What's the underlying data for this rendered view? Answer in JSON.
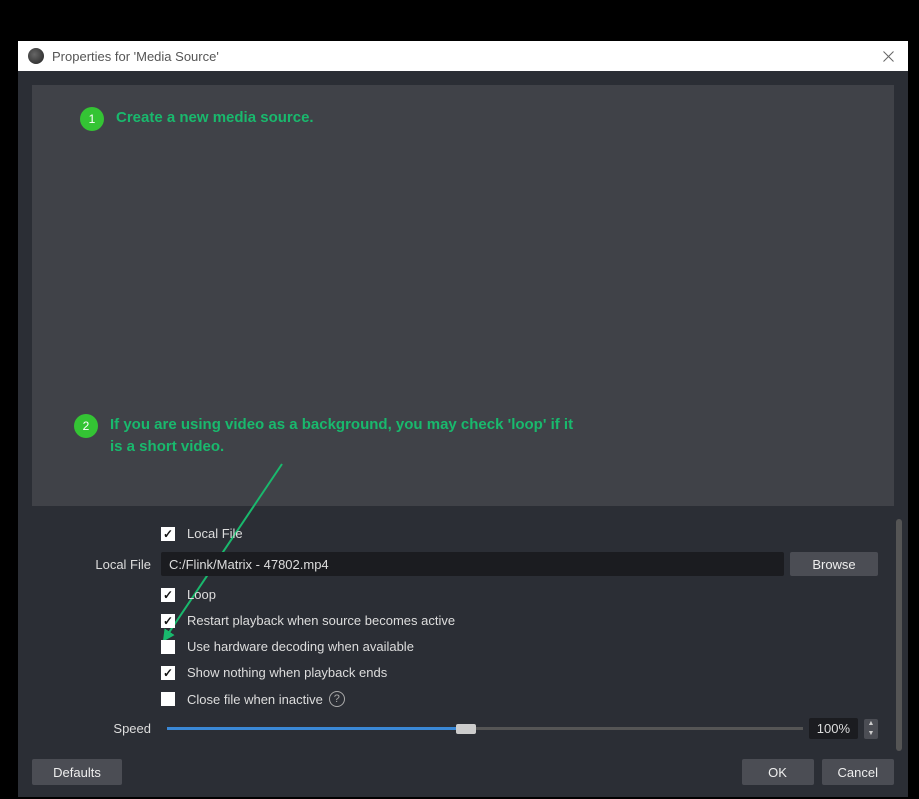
{
  "titlebar": {
    "title": "Properties for 'Media Source'"
  },
  "annotations": {
    "a1": {
      "num": "1",
      "text": "Create a new media source."
    },
    "a2": {
      "num": "2",
      "text": "If you are using video as a background, you may check 'loop' if it is a short video."
    }
  },
  "form": {
    "local_file_check": "Local File",
    "local_file_label": "Local File",
    "local_file_value": "C:/Flink/Matrix - 47802.mp4",
    "browse_label": "Browse",
    "loop_label": "Loop",
    "restart_label": "Restart playback when source becomes active",
    "hw_decode_label": "Use hardware decoding when available",
    "show_nothing_label": "Show nothing when playback ends",
    "close_inactive_label": "Close file when inactive",
    "speed_label": "Speed",
    "speed_value": "100%",
    "speed_percent": 47
  },
  "buttons": {
    "defaults": "Defaults",
    "ok": "OK",
    "cancel": "Cancel"
  }
}
